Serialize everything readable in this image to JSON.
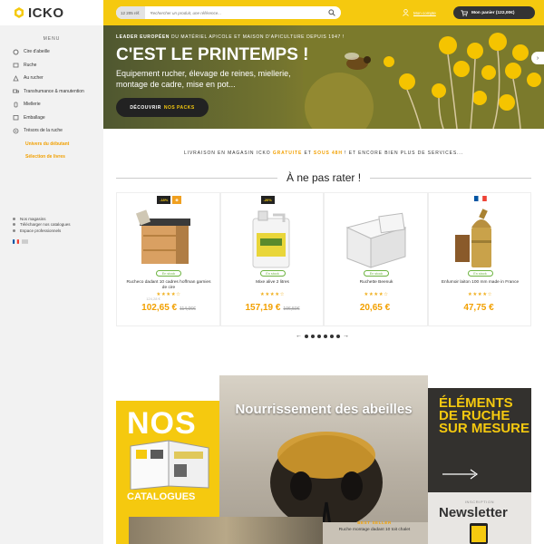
{
  "brand": {
    "name": "ICKO",
    "color": "#f5c90f"
  },
  "sidebar": {
    "menu_title": "MENU",
    "items": [
      {
        "label": "Cire d'abeille",
        "icon": "gear-icon"
      },
      {
        "label": "Ruche",
        "icon": "hive-icon"
      },
      {
        "label": "Au rucher",
        "icon": "apiary-icon"
      },
      {
        "label": "Transhumance & manutention",
        "icon": "truck-icon"
      },
      {
        "label": "Miellerie",
        "icon": "honey-icon"
      },
      {
        "label": "Emballage",
        "icon": "package-icon"
      },
      {
        "label": "Trésors de la ruche",
        "icon": "treasure-icon"
      }
    ],
    "sub_items": [
      "Univers du débutant",
      "Sélection de livres"
    ],
    "footer": [
      "Nos magasins",
      "Télécharger nos catalogues",
      "Espace professionnels"
    ]
  },
  "header": {
    "search_count": "12 205 réf.",
    "search_placeholder": "Rechercher un produit, une référence...",
    "account_label": "Mon compte",
    "cart_label": "Mon panier (122,00€)"
  },
  "hero": {
    "tag_bold": "LEADER EUROPÉEN",
    "tag_rest": " DU MATÉRIEL APICOLE ET MAISON D'APICULTURE DEPUIS 1947 !",
    "title": "C'EST LE PRINTEMPS !",
    "subtitle": "Equipement rucher, élevage de reines, miellerie, montage de cadre, mise en pot...",
    "button_prefix": "DÉCOUVRIR",
    "button_highlight": "NOS PACKS"
  },
  "info": {
    "part1": "LIVRAISON EN MAGASIN ICKO ",
    "free": "GRATUITE",
    "part2": " ET ",
    "time": "SOUS 48H",
    "part3": " ! ET ENCORE BIEN PLUS DE SERVICES..."
  },
  "section_title": "À ne pas rater !",
  "products": [
    {
      "badges": [
        "-18%",
        "⊕"
      ],
      "stock": "En stock",
      "name": "Rucheco dadant 10 cadres hoffman garnies de cire",
      "old_top": "124,28 €",
      "stars": "★★★★☆",
      "price": "102,65 €",
      "old": "114,06€"
    },
    {
      "badges": [
        "-20%"
      ],
      "stock": "En stock",
      "name": "Mixe alive 2 litres",
      "old_top": "",
      "stars": "★★★★☆",
      "price": "157,19 €",
      "old": "196,50€"
    },
    {
      "badges": [],
      "stock": "En stock",
      "name": "Ruchette Beenuk",
      "old_top": "",
      "stars": "★★★★☆",
      "price": "20,65 €",
      "old": ""
    },
    {
      "badges": [],
      "stock": "En stock",
      "name": "Enfumoir laiton 100 mm made in France",
      "old_top": "",
      "stars": "★★★★☆",
      "price": "47,75 €",
      "old": ""
    }
  ],
  "bottom": {
    "catalog_big": "NOS",
    "catalog_small": "CATALOGUES",
    "bee_title": "Nourrissement des abeilles",
    "elements_title": "ÉLÉMENTS DE RUCHE SUR MESURE",
    "newsletter_sub": "INSCRIPTION",
    "newsletter_title": "Newsletter",
    "best_label": "BEST SELLER",
    "best_name": "Ruche montage dadant 10 toit chalet"
  }
}
